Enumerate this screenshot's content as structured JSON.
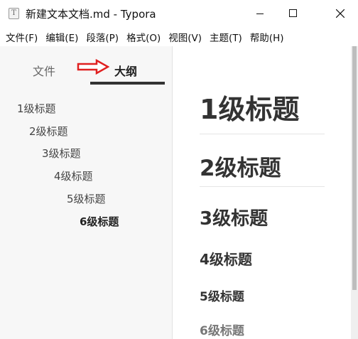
{
  "window": {
    "title": "新建文本文档.md - Typora",
    "app_icon_letter": "T",
    "minimize": "minimize",
    "maximize": "maximize",
    "close": "close"
  },
  "menubar": {
    "items": [
      "文件(F)",
      "编辑(E)",
      "段落(P)",
      "格式(O)",
      "视图(V)",
      "主题(T)",
      "帮助(H)"
    ]
  },
  "sidebar": {
    "tabs": [
      {
        "label": "文件"
      },
      {
        "label": "大纲",
        "active": true
      }
    ],
    "annotation_arrow_color": "#e02020",
    "outline": [
      {
        "label": "1级标题"
      },
      {
        "label": "2级标题"
      },
      {
        "label": "3级标题"
      },
      {
        "label": "4级标题"
      },
      {
        "label": "5级标题"
      },
      {
        "label": "6级标题",
        "active": true
      }
    ]
  },
  "document": {
    "headings": [
      {
        "level": 1,
        "text": "1级标题"
      },
      {
        "level": 2,
        "text": "2级标题"
      },
      {
        "level": 3,
        "text": "3级标题"
      },
      {
        "level": 4,
        "text": "4级标题"
      },
      {
        "level": 5,
        "text": "5级标题"
      },
      {
        "level": 6,
        "text": "6级标题"
      }
    ]
  }
}
